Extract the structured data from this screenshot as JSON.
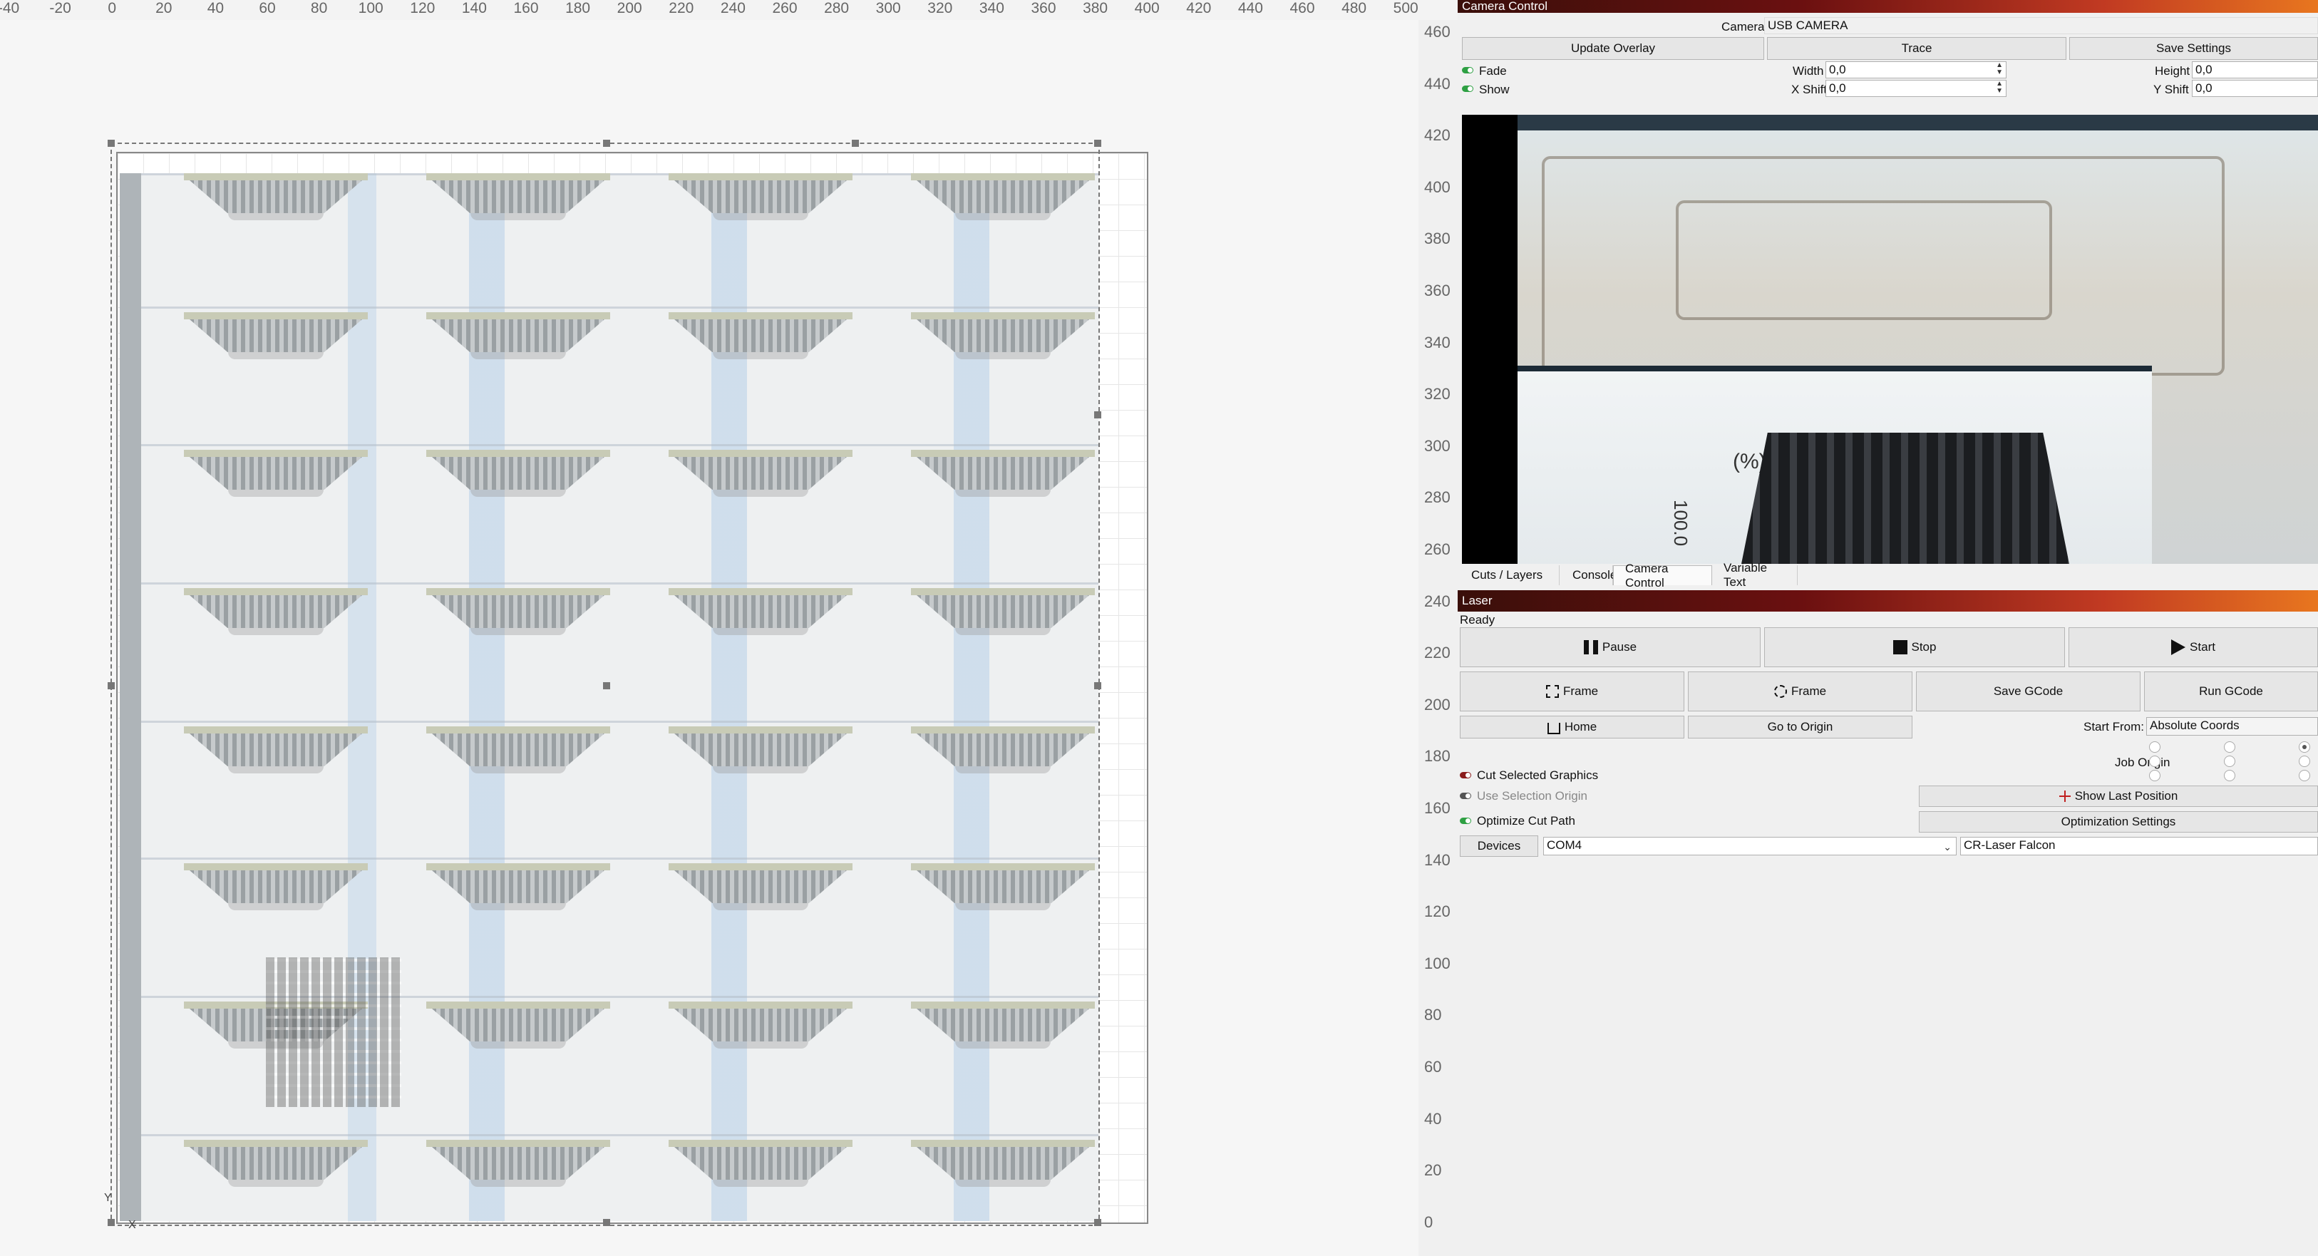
{
  "ruler": {
    "top_ticks": [
      "-40",
      "-20",
      "0",
      "20",
      "40",
      "60",
      "80",
      "100",
      "120",
      "140",
      "160",
      "180",
      "200",
      "220",
      "240",
      "260",
      "280",
      "300",
      "320",
      "340",
      "360",
      "380",
      "400",
      "420",
      "440",
      "460",
      "480",
      "500"
    ],
    "left_ticks": [
      "460",
      "440",
      "420",
      "400",
      "380",
      "360",
      "340",
      "320",
      "300",
      "280",
      "260",
      "240",
      "220",
      "200",
      "180",
      "160",
      "140",
      "120",
      "100",
      "80",
      "60",
      "40",
      "20",
      "0"
    ]
  },
  "canvas": {
    "axis_x": "X",
    "axis_y": "Y"
  },
  "camera_control": {
    "title": "Camera Control",
    "camera_label": "Camera:",
    "camera_value": "USB CAMERA",
    "update_overlay": "Update Overlay",
    "trace": "Trace",
    "save_settings": "Save Settings",
    "fade_label": "Fade",
    "show_label": "Show",
    "width_label": "Width",
    "width_value": "0,0",
    "height_label": "Height",
    "height_value": "0,0",
    "xshift_label": "X Shift",
    "xshift_value": "0,0",
    "yshift_label": "Y Shift",
    "yshift_value": "0,0",
    "cam_text_percent": "(%)",
    "cam_text_num": "100.0"
  },
  "tabs": [
    "Cuts / Layers",
    "Console",
    "Camera Control",
    "Variable Text"
  ],
  "laser": {
    "title": "Laser",
    "status": "Ready",
    "pause": "Pause",
    "stop": "Stop",
    "start": "Start",
    "frame1": "Frame",
    "frame2": "Frame",
    "save_gcode": "Save GCode",
    "run_gcode": "Run GCode",
    "home": "Home",
    "go_to_origin": "Go to Origin",
    "start_from_label": "Start From:",
    "start_from_value": "Absolute Coords",
    "job_origin_label": "Job Origin",
    "cut_selected": "Cut Selected Graphics",
    "use_selection_origin": "Use Selection Origin",
    "optimize_cut_path": "Optimize Cut Path",
    "show_last_position": "Show Last Position",
    "optimization_settings": "Optimization Settings",
    "devices": "Devices",
    "port_value": "COM4",
    "device_value": "CR-Laser Falcon"
  },
  "colors": {
    "accent_start": "#3a0f0a",
    "accent_end": "#e8761f",
    "toggle_on": "#2ea043"
  }
}
